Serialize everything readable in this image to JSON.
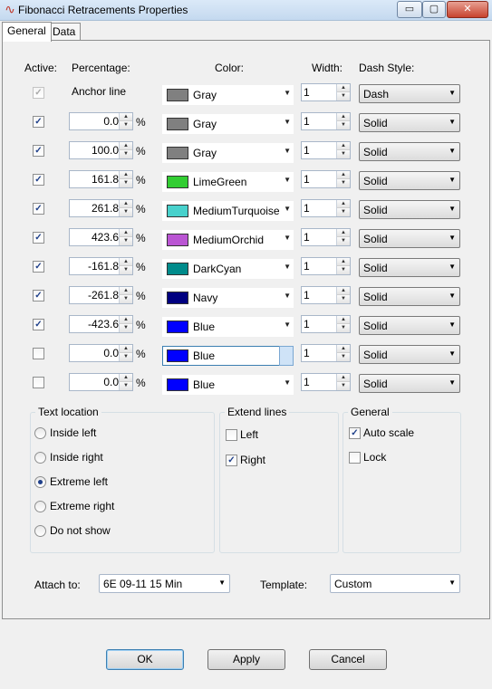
{
  "window": {
    "title": "Fibonacci Retracements Properties",
    "controls": {
      "minimize": "▭",
      "restore": "▢",
      "close": "✕"
    }
  },
  "tabs": [
    "General",
    "Data"
  ],
  "headers": {
    "active": "Active:",
    "percentage": "Percentage:",
    "color": "Color:",
    "width": "Width:",
    "dash_style": "Dash Style:"
  },
  "rows": [
    {
      "active": true,
      "disabled": true,
      "percentage": "Anchor line",
      "color": "Gray",
      "color_hex": "#808080",
      "width": "1",
      "dash": "Dash"
    },
    {
      "active": true,
      "percentage": "0.0",
      "color": "Gray",
      "color_hex": "#808080",
      "width": "1",
      "dash": "Solid"
    },
    {
      "active": true,
      "percentage": "100.0",
      "color": "Gray",
      "color_hex": "#808080",
      "width": "1",
      "dash": "Solid"
    },
    {
      "active": true,
      "percentage": "161.8",
      "color": "LimeGreen",
      "color_hex": "#32cd32",
      "width": "1",
      "dash": "Solid"
    },
    {
      "active": true,
      "percentage": "261.8",
      "color": "MediumTurquoise",
      "color_hex": "#48d1cc",
      "width": "1",
      "dash": "Solid"
    },
    {
      "active": true,
      "percentage": "423.6",
      "color": "MediumOrchid",
      "color_hex": "#ba55d3",
      "width": "1",
      "dash": "Solid"
    },
    {
      "active": true,
      "percentage": "-161.8",
      "color": "DarkCyan",
      "color_hex": "#008b8b",
      "width": "1",
      "dash": "Solid"
    },
    {
      "active": true,
      "percentage": "-261.8",
      "color": "Navy",
      "color_hex": "#000080",
      "width": "1",
      "dash": "Solid"
    },
    {
      "active": true,
      "percentage": "-423.6",
      "color": "Blue",
      "color_hex": "#0000ff",
      "width": "1",
      "dash": "Solid"
    },
    {
      "active": false,
      "percentage": "0.0",
      "color": "Blue",
      "color_hex": "#0000ff",
      "width": "1",
      "dash": "Solid",
      "focused": true
    },
    {
      "active": false,
      "percentage": "0.0",
      "color": "Blue",
      "color_hex": "#0000ff",
      "width": "1",
      "dash": "Solid"
    }
  ],
  "percent_sign": "%",
  "text_location": {
    "label": "Text location",
    "options": [
      "Inside left",
      "Inside right",
      "Extreme left",
      "Extreme right",
      "Do not show"
    ],
    "selected": "Extreme left"
  },
  "extend_lines": {
    "label": "Extend lines",
    "left": {
      "label": "Left",
      "checked": false
    },
    "right": {
      "label": "Right",
      "checked": true
    }
  },
  "general_group": {
    "label": "General",
    "auto_scale": {
      "label": "Auto scale",
      "checked": true
    },
    "lock": {
      "label": "Lock",
      "checked": false
    }
  },
  "attach": {
    "label": "Attach to:",
    "value": "6E 09-11 15 Min"
  },
  "template": {
    "label": "Template:",
    "value": "Custom"
  },
  "buttons": {
    "ok": "OK",
    "apply": "Apply",
    "cancel": "Cancel"
  }
}
